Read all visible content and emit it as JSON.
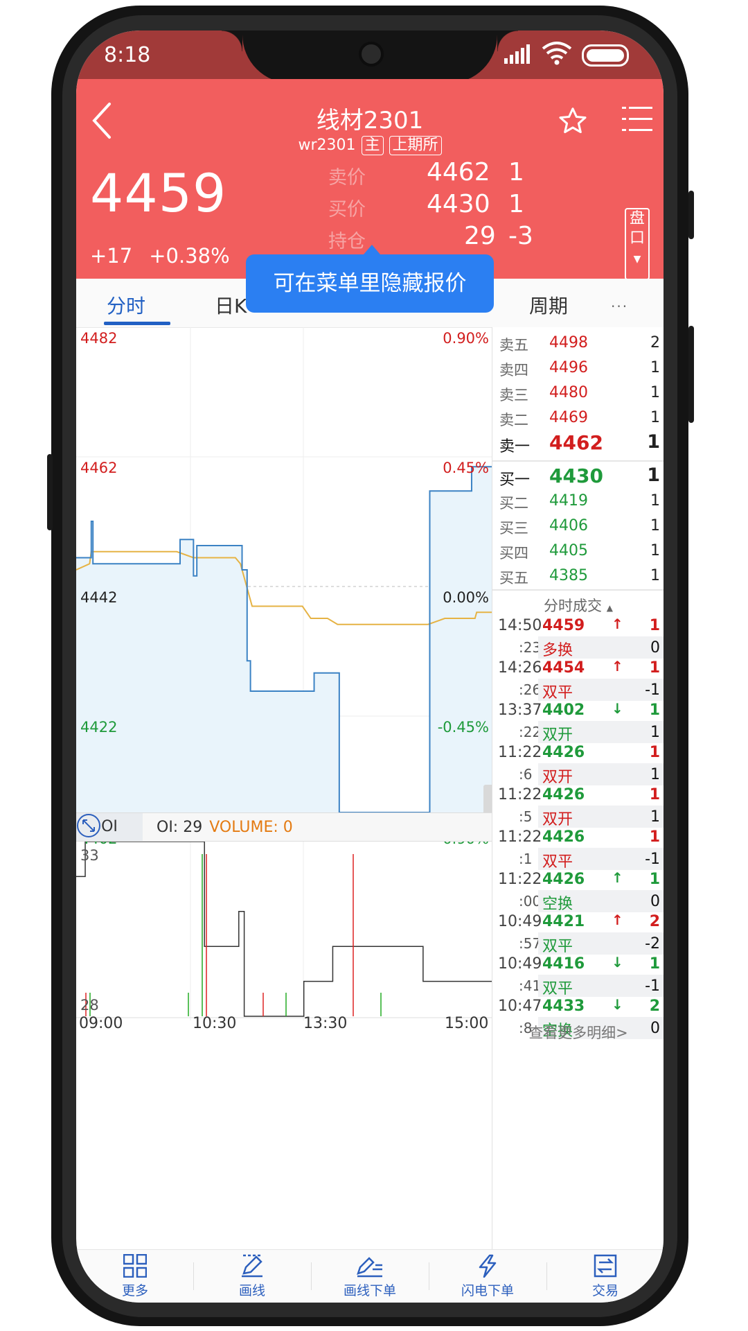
{
  "status": {
    "time": "8:18"
  },
  "header": {
    "title": "线材2301",
    "code": "wr2301",
    "tag_main": "主",
    "tag_exchange": "上期所",
    "price": "4459",
    "change": "+17",
    "change_pct": "+0.38%",
    "quote": [
      {
        "label": "卖价",
        "value": "4462",
        "qty": "1"
      },
      {
        "label": "买价",
        "value": "4430",
        "qty": "1"
      },
      {
        "label": "持仓",
        "value": "29",
        "qty": "-3"
      }
    ],
    "pankou": "盘口"
  },
  "tabs": [
    "分时",
    "日K",
    "周期",
    "···"
  ],
  "tooltip": "可在菜单里隐藏报价",
  "chart": {
    "y_left": [
      "4482",
      "4462",
      "4442",
      "4422",
      "4402"
    ],
    "y_right": [
      "0.90%",
      "0.45%",
      "0.00%",
      "-0.45%",
      "-0.90%"
    ],
    "oi_selector": "OI",
    "oi_label": "OI: 29",
    "volume_label": "VOLUME: 0",
    "oi_top": "33",
    "oi_bottom": "28",
    "x_labels": [
      "09:00",
      "10:30",
      "13:30",
      "15:00"
    ]
  },
  "chart_data": {
    "type": "line",
    "x": [
      "09:00",
      "09:10",
      "10:30",
      "10:50",
      "11:22",
      "13:00",
      "13:30",
      "14:26",
      "14:50",
      "15:00"
    ],
    "series": [
      {
        "values": [
          4446,
          4448,
          4452,
          4433,
          4423,
          4402,
          4402,
          4455,
          4459,
          4459
        ]
      },
      {
        "values": [
          4442,
          4445,
          4444,
          4440,
          4438,
          4437,
          4437,
          4436,
          4438,
          4438
        ]
      }
    ],
    "ylim": [
      4402,
      4482
    ]
  },
  "book": {
    "asks": [
      {
        "name": "卖五",
        "price": "4498",
        "vol": "2"
      },
      {
        "name": "卖四",
        "price": "4496",
        "vol": "1"
      },
      {
        "name": "卖三",
        "price": "4480",
        "vol": "1"
      },
      {
        "name": "卖二",
        "price": "4469",
        "vol": "1"
      },
      {
        "name": "卖一",
        "price": "4462",
        "vol": "1"
      }
    ],
    "bids": [
      {
        "name": "买一",
        "price": "4430",
        "vol": "1"
      },
      {
        "name": "买二",
        "price": "4419",
        "vol": "1"
      },
      {
        "name": "买三",
        "price": "4406",
        "vol": "1"
      },
      {
        "name": "买四",
        "price": "4405",
        "vol": "1"
      },
      {
        "name": "买五",
        "price": "4385",
        "vol": "1"
      }
    ],
    "trades_header": "分时成交",
    "trades": [
      {
        "time": "14:50",
        "sec": ":23",
        "price": "4459",
        "arrow": "↑",
        "qty": "1",
        "type": "多换",
        "delta": "0",
        "pc": "up",
        "ac": "up",
        "tc": "up"
      },
      {
        "time": "14:26",
        "sec": ":26",
        "price": "4454",
        "arrow": "↑",
        "qty": "1",
        "type": "双平",
        "delta": "-1",
        "pc": "up",
        "ac": "up",
        "tc": "up"
      },
      {
        "time": "13:37",
        "sec": ":22",
        "price": "4402",
        "arrow": "↓",
        "qty": "1",
        "type": "双开",
        "delta": "1",
        "pc": "dn",
        "ac": "dn",
        "tc": "dn"
      },
      {
        "time": "11:22",
        "sec": ":6",
        "price": "4426",
        "arrow": "",
        "qty": "1",
        "type": "双开",
        "delta": "1",
        "pc": "dn",
        "ac": "up",
        "tc": "up"
      },
      {
        "time": "11:22",
        "sec": ":5",
        "price": "4426",
        "arrow": "",
        "qty": "1",
        "type": "双开",
        "delta": "1",
        "pc": "dn",
        "ac": "up",
        "tc": "up"
      },
      {
        "time": "11:22",
        "sec": ":1",
        "price": "4426",
        "arrow": "",
        "qty": "1",
        "type": "双平",
        "delta": "-1",
        "pc": "dn",
        "ac": "up",
        "tc": "up"
      },
      {
        "time": "11:22",
        "sec": ":00",
        "price": "4426",
        "arrow": "↑",
        "qty": "1",
        "type": "空换",
        "delta": "0",
        "pc": "dn",
        "ac": "dn",
        "tc": "dn"
      },
      {
        "time": "10:49",
        "sec": ":57",
        "price": "4421",
        "arrow": "↑",
        "qty": "2",
        "type": "双平",
        "delta": "-2",
        "pc": "dn",
        "ac": "up",
        "tc": "dn"
      },
      {
        "time": "10:49",
        "sec": ":41",
        "price": "4416",
        "arrow": "↓",
        "qty": "1",
        "type": "双平",
        "delta": "-1",
        "pc": "dn",
        "ac": "dn",
        "tc": "dn"
      },
      {
        "time": "10:47",
        "sec": ":8",
        "price": "4433",
        "arrow": "↓",
        "qty": "2",
        "type": "空换",
        "delta": "0",
        "pc": "dn",
        "ac": "dn",
        "tc": "dn"
      }
    ],
    "see_more": "查看更多明细>"
  },
  "bottom": [
    "更多",
    "画线",
    "画线下单",
    "闪电下单",
    "交易"
  ],
  "colors": {
    "header": "#f25e5e",
    "accent": "#2160c4",
    "up": "#d21e1e",
    "down": "#1f9a3b"
  }
}
